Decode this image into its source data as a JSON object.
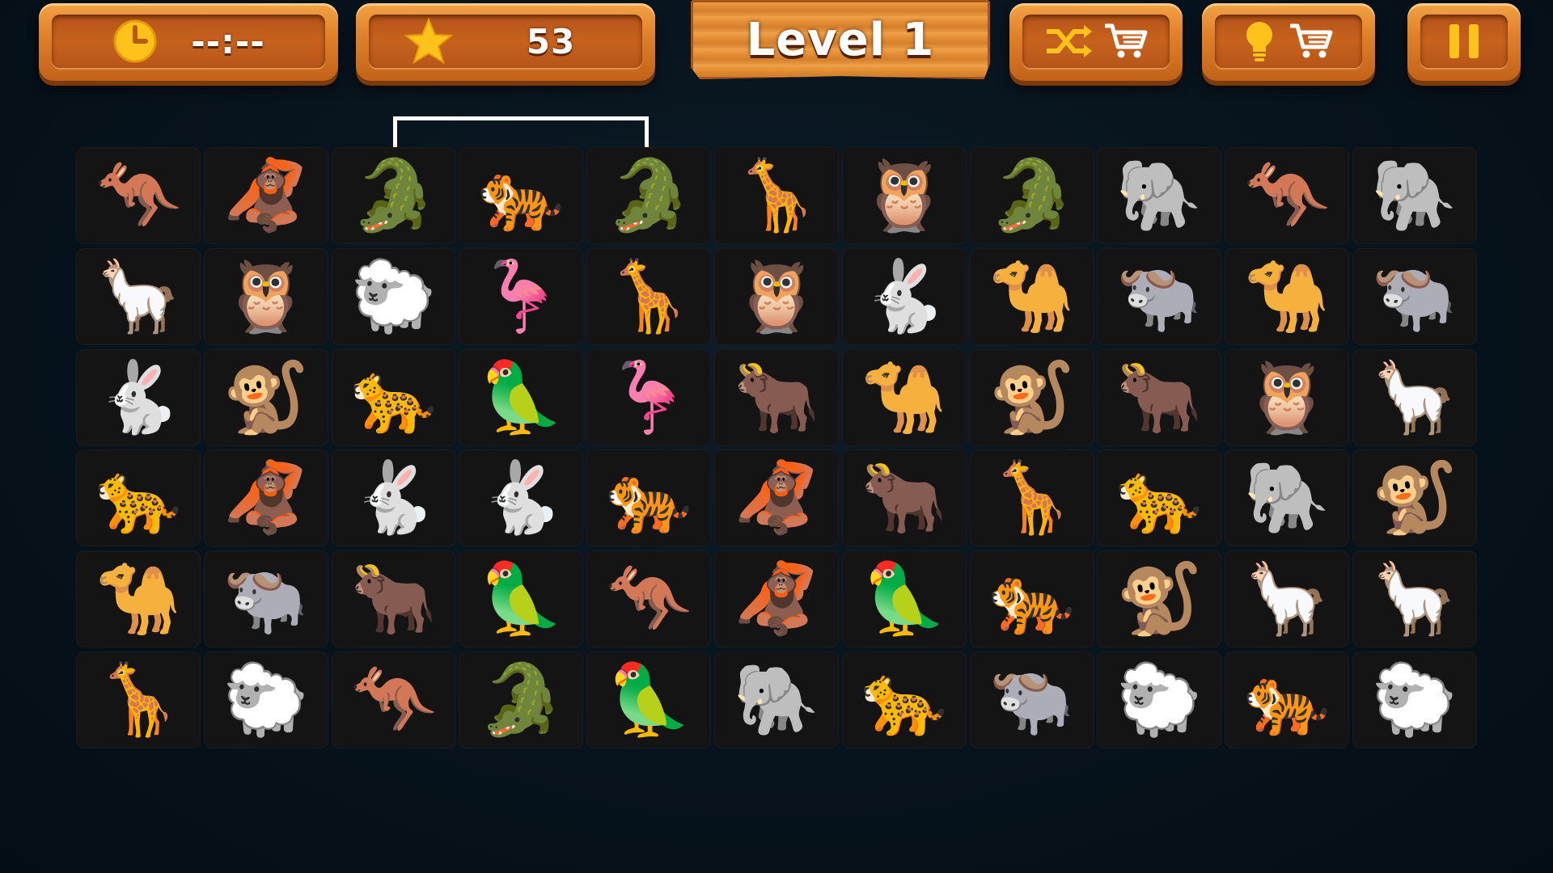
{
  "hud": {
    "timer_text": "--:--",
    "score": "53",
    "level_title": "Level 1"
  },
  "icons": {
    "timer": "clock-icon",
    "score": "star-icon",
    "shuffle": "shuffle-icon",
    "shuffle_cart": "cart-icon",
    "hint": "lightbulb-icon",
    "hint_cart": "cart-icon",
    "pause": "pause-icon"
  },
  "colors": {
    "wood_light": "#f3a346",
    "wood_dark": "#c2621a",
    "background": "#07131c",
    "tile": "#141414",
    "selection": "#ffffff"
  },
  "board": {
    "rows": 6,
    "cols": 11,
    "selected": [
      [
        0,
        2
      ],
      [
        0,
        4
      ]
    ],
    "path_hint": "connector between two crocodile tiles above row 0",
    "grid": [
      [
        "kangaroo",
        "orangutan",
        "crocodile",
        "tiger",
        "crocodile",
        "giraffe",
        "owl",
        "crocodile",
        "elephant",
        "kangaroo",
        "elephant"
      ],
      [
        "llama",
        "owl",
        "sheep",
        "flamingo",
        "giraffe",
        "owl",
        "rabbit",
        "camel",
        "water-buffalo",
        "camel",
        "water-buffalo"
      ],
      [
        "rabbit",
        "monkey",
        "leopard",
        "parrot",
        "flamingo",
        "ox",
        "camel",
        "monkey",
        "ox",
        "owl",
        "llama"
      ],
      [
        "leopard",
        "orangutan",
        "rabbit",
        "rabbit",
        "tiger",
        "orangutan",
        "ox",
        "giraffe",
        "leopard",
        "elephant",
        "monkey"
      ],
      [
        "camel",
        "water-buffalo",
        "ox",
        "parrot",
        "kangaroo",
        "orangutan",
        "parrot",
        "tiger",
        "monkey",
        "llama",
        "llama"
      ],
      [
        "giraffe",
        "sheep",
        "kangaroo",
        "crocodile",
        "parrot",
        "elephant",
        "leopard",
        "water-buffalo",
        "sheep",
        "tiger",
        "sheep"
      ]
    ]
  }
}
